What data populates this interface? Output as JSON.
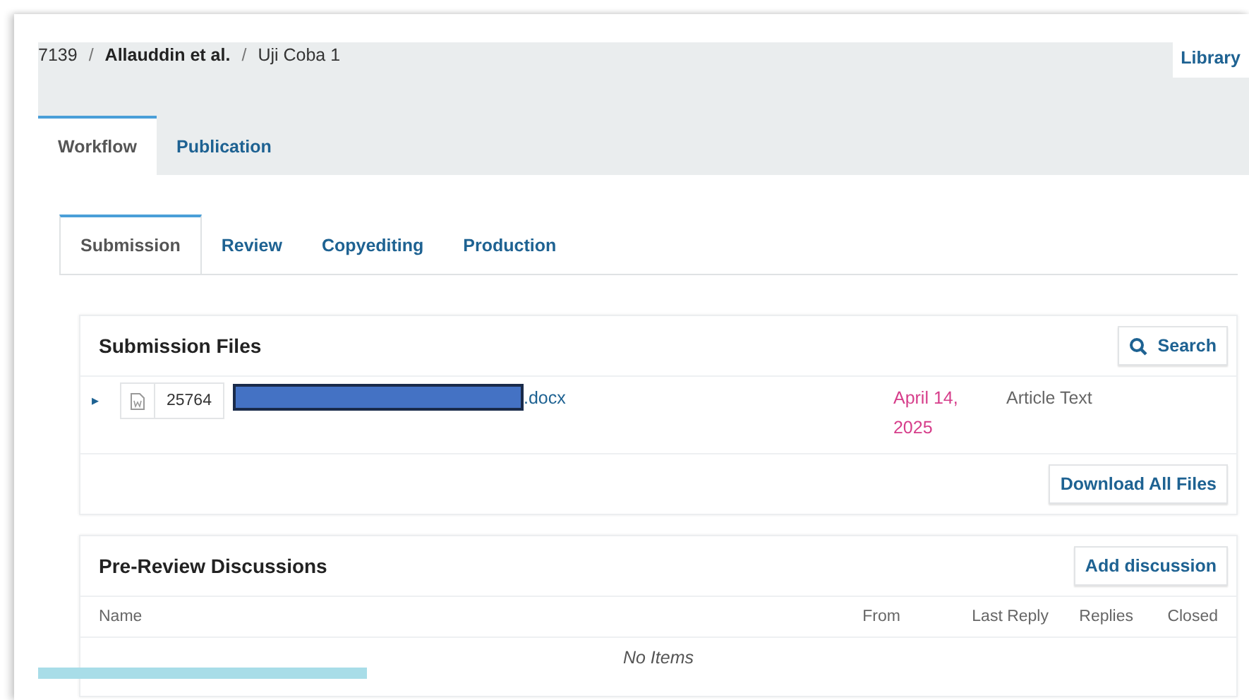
{
  "breadcrumb": {
    "id": "7139",
    "separator": "/",
    "authors": "Allauddin et al.",
    "title": "Uji Coba 1"
  },
  "library_button": "Library",
  "tabs": [
    {
      "label": "Workflow",
      "selected": true
    },
    {
      "label": "Publication",
      "selected": false
    }
  ],
  "stage_tabs": [
    {
      "label": "Submission",
      "selected": true
    },
    {
      "label": "Review",
      "selected": false
    },
    {
      "label": "Copyediting",
      "selected": false
    },
    {
      "label": "Production",
      "selected": false
    }
  ],
  "submission_files": {
    "title": "Submission Files",
    "search_button": "Search",
    "files": [
      {
        "expand_icon": "▸",
        "id": "25764",
        "name_redacted": true,
        "name": ".docx",
        "date": "April 14, 2025",
        "component": "Article Text"
      }
    ],
    "download_button": "Download All Files"
  },
  "discussions": {
    "title": "Pre-Review Discussions",
    "add_button": "Add discussion",
    "columns": [
      "Name",
      "From",
      "Last Reply",
      "Replies",
      "Closed"
    ],
    "empty_text": "No Items"
  },
  "status_bar": {
    "visible": true
  }
}
